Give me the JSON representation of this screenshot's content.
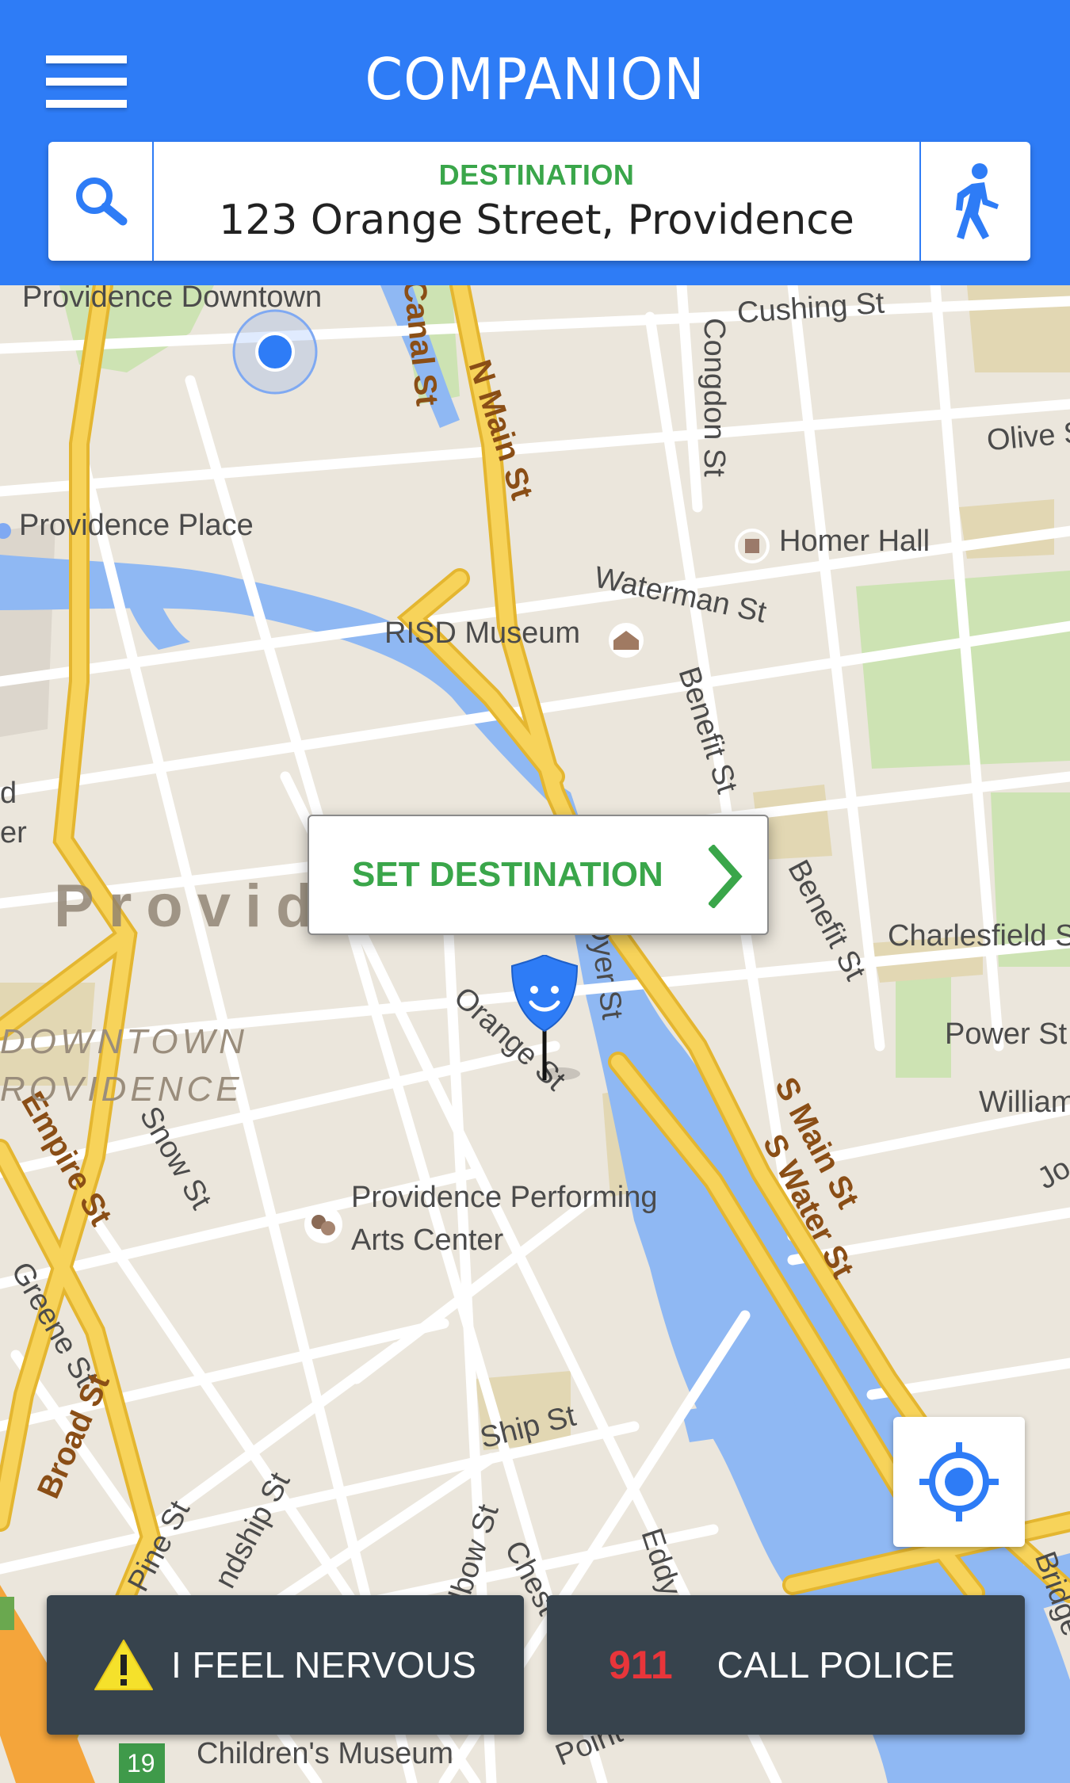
{
  "header": {
    "app_title": "COMPANION",
    "menu_icon": "hamburger-menu-icon",
    "search_icon": "search-icon",
    "destination_label": "DESTINATION",
    "destination_value": "123 Orange Street, Providence",
    "travel_mode_icon": "walking-person-icon",
    "background_color": "#2e7cf6"
  },
  "map": {
    "labels": {
      "providence_downtown": "Providence Downtown",
      "providence_place": "Providence Place",
      "risd_museum": "RISD Museum",
      "homer_hall": "Homer Hall",
      "cushing_st": "Cushing St",
      "congdon_st": "Congdon St",
      "olive_st": "Olive S",
      "waterman_st": "Waterman St",
      "benefit_st_1": "Benefit St",
      "benefit_st_2": "Benefit St",
      "charlesfield_st": "Charlesfield S",
      "power_st": "Power St",
      "william_st": "William",
      "orange_st": "Orange St",
      "dyer_st": "Dyer St",
      "ppac_line1": "Providence Performing",
      "ppac_line2": "Arts Center",
      "snow_st": "Snow St",
      "greene_st": "Greene St",
      "ship_st": "Ship St",
      "elbow_st": "Elbow St",
      "chest": "Chest",
      "eddy": "Eddy",
      "pine_st": "Pine St",
      "township_st": "ndship St",
      "bridge": "Bridge",
      "point": "Point",
      "childrens_museum": "Children's Museum",
      "route_19": "19",
      "jo": "Jo",
      "d_edge": "d",
      "er_edge": "er"
    },
    "road_labels": {
      "canal_st": "Canal St",
      "n_main_st": "N Main St",
      "s_main_st": "S Main St",
      "s_water_st": "S Water St",
      "empire_st": "Empire St",
      "broad_st": "Broad St"
    },
    "district_name": "Provid",
    "district_downtown_1": "DOWNTOWN",
    "district_downtown_2": "ROVIDENCE",
    "colors": {
      "land": "#ebe6dc",
      "major_road": "#f7d35a",
      "minor_road": "#ffffff",
      "water": "#8fb8f3",
      "park": "#cde3b3",
      "building": "#e2d7b3"
    }
  },
  "callout": {
    "label": "SET DESTINATION",
    "chevron_icon": "chevron-right-icon",
    "color": "#3aa64a"
  },
  "pin": {
    "icon": "shield-face-pin-icon",
    "color": "#2e7cf6"
  },
  "locate_button": {
    "icon": "crosshair-locate-icon"
  },
  "actions": {
    "nervous": {
      "icon": "warning-icon",
      "label": "I FEEL NERVOUS"
    },
    "police": {
      "number": "911",
      "label": "CALL POLICE"
    }
  }
}
